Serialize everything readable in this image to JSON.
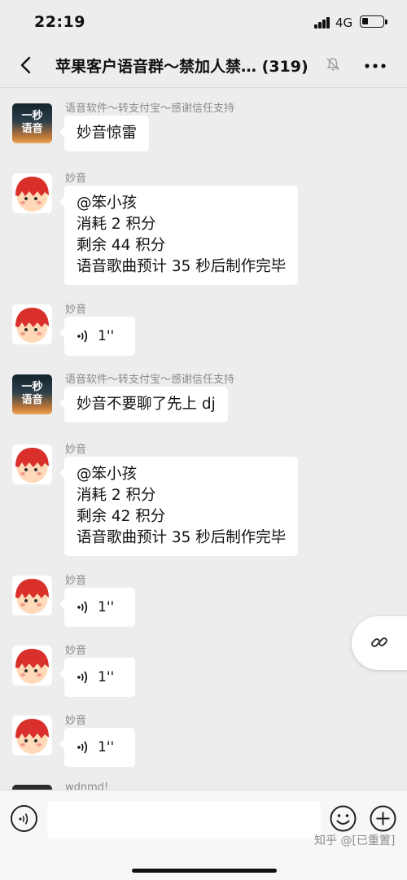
{
  "status_bar": {
    "time": "22:19",
    "network": "4G"
  },
  "header": {
    "title": "苹果客户语音群～禁加人禁…",
    "member_count": "(319)"
  },
  "messages": [
    {
      "sender": "语音软件～转支付宝～感谢信任支持",
      "avatar": "yimiao-yuyin-logo",
      "type": "text",
      "lines": [
        "妙音惊雷"
      ]
    },
    {
      "sender": "妙音",
      "avatar": "red-hair-mascot",
      "type": "text",
      "lines": [
        "@笨小孩",
        "消耗 2 积分",
        "剩余 44 积分",
        "语音歌曲预计 35 秒后制作完毕"
      ]
    },
    {
      "sender": "妙音",
      "avatar": "red-hair-mascot",
      "type": "voice",
      "duration": "1''"
    },
    {
      "sender": "语音软件～转支付宝～感谢信任支持",
      "avatar": "yimiao-yuyin-logo",
      "type": "text",
      "lines": [
        "妙音不要聊了先上 dj"
      ]
    },
    {
      "sender": "妙音",
      "avatar": "red-hair-mascot",
      "type": "text",
      "lines": [
        "@笨小孩",
        "消耗 2 积分",
        "剩余 42 积分",
        "语音歌曲预计 35 秒后制作完毕"
      ]
    },
    {
      "sender": "妙音",
      "avatar": "red-hair-mascot",
      "type": "voice",
      "duration": "1''"
    },
    {
      "sender": "妙音",
      "avatar": "red-hair-mascot",
      "type": "voice",
      "duration": "1''"
    },
    {
      "sender": "妙音",
      "avatar": "red-hair-mascot",
      "type": "voice",
      "duration": "1''"
    },
    {
      "sender": "wdnmd!",
      "avatar": "dark-photo",
      "type": "partial"
    }
  ],
  "logo_text": {
    "line1": "一秒",
    "line2": "语音"
  },
  "input_bar": {
    "placeholder": ""
  },
  "watermark": "知乎 @[已重置]",
  "icons": [
    "back-arrow-icon",
    "mute-bell-icon",
    "more-dots-icon",
    "voice-wave-icon",
    "link-icon",
    "voice-toggle-icon",
    "emoji-icon",
    "plus-icon"
  ],
  "colors": {
    "background": "#ededed",
    "bubble": "#ffffff",
    "sender_text": "#8a8a8a",
    "mascot_red": "#d9302c"
  }
}
